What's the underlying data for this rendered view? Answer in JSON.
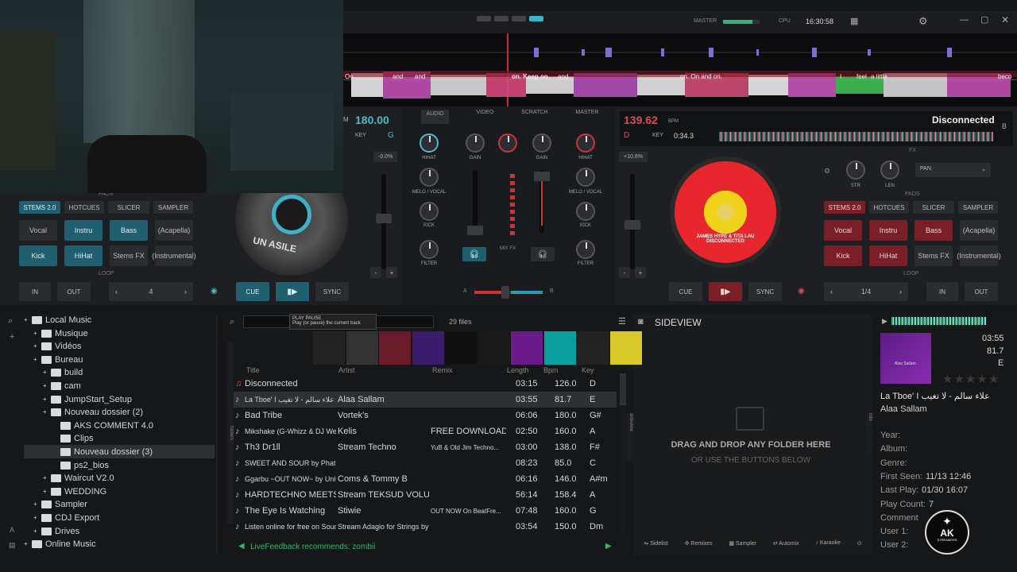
{
  "colors": {
    "teal": "#1f5f70",
    "red": "#8a1e2a",
    "accent": "#4fb8c8"
  },
  "topbar": {
    "master_label": "MASTER",
    "cpu_label": "CPU",
    "time": "16:30:58"
  },
  "lyrics": [
    "On",
    "and",
    "on. Keep on",
    "and",
    "on. On and on.",
    "I",
    "feel",
    "a little",
    "beco"
  ],
  "deck_left": {
    "bpm": "180.00",
    "key_label": "KEY",
    "key_value": "G",
    "pitch": "-0.0%",
    "pads_label": "PADS",
    "pad_modes": [
      "STEMS 2.0",
      "HOTCUES",
      "SLICER",
      "SAMPLER"
    ],
    "pads": [
      "Vocal",
      "Instru",
      "Bass",
      "(Acapella)",
      "Kick",
      "HiHat",
      "Stems FX",
      "(Instrumental)"
    ],
    "loop_label": "LOOP",
    "loop_in": "IN",
    "loop_out": "OUT",
    "loop_size": "4",
    "cue": "CUE",
    "sync": "SYNC",
    "platter_text": "UN ASILE"
  },
  "deck_right": {
    "bpm": "139.62",
    "bpm_label": "BPM",
    "key_value": "D",
    "key_label": "KEY",
    "time": "0:34.3",
    "title": "Disconnected",
    "deck_letter": "B",
    "pitch": "+10.6%",
    "fx_label": "FX",
    "fx_knobs": [
      "STR",
      "LEN"
    ],
    "fx_select": "PAN",
    "pads_label": "PADS",
    "pad_modes": [
      "STEMS 2.0",
      "HOTCUES",
      "SLICER",
      "SAMPLER"
    ],
    "pads": [
      "Vocal",
      "Instru",
      "Bass",
      "(Acapella)",
      "Kick",
      "HiHat",
      "Stems FX",
      "(Instrumental)"
    ],
    "loop_label": "LOOP",
    "loop_in": "IN",
    "loop_out": "OUT",
    "loop_size": "1/4",
    "cue": "CUE",
    "sync": "SYNC",
    "platter_text": "JAMES HYPE & TITA LAU DISCONNECTED"
  },
  "mixer": {
    "tabs": [
      "AUDIO",
      "VIDEO",
      "SCRATCH",
      "MASTER"
    ],
    "left_knobs": [
      "HIHAT",
      "MELO / VOCAL",
      "KICK",
      "FILTER"
    ],
    "right_knobs": [
      "HIHAT",
      "MELO / VOCAL",
      "KICK",
      "FILTER"
    ],
    "gain": "GAIN",
    "mixfx": "MIX FX",
    "cross_a": "A",
    "cross_b": "B"
  },
  "tree": [
    {
      "label": "Local Music",
      "indent": 0
    },
    {
      "label": "Musique",
      "indent": 1
    },
    {
      "label": "Vidéos",
      "indent": 1
    },
    {
      "label": "Bureau",
      "indent": 1
    },
    {
      "label": "build",
      "indent": 2
    },
    {
      "label": "cam",
      "indent": 2
    },
    {
      "label": "JumpStart_Setup",
      "indent": 2
    },
    {
      "label": "Nouveau dossier (2)",
      "indent": 2
    },
    {
      "label": "AKS COMMENT 4.0",
      "indent": 3
    },
    {
      "label": "Clips",
      "indent": 3
    },
    {
      "label": "Nouveau dossier (3)",
      "indent": 3
    },
    {
      "label": "ps2_bios",
      "indent": 3
    },
    {
      "label": "Waircut V2.0",
      "indent": 2
    },
    {
      "label": "WEDDING",
      "indent": 2
    },
    {
      "label": "Sampler",
      "indent": 1
    },
    {
      "label": "CDJ Export",
      "indent": 1
    },
    {
      "label": "Drives",
      "indent": 1
    },
    {
      "label": "Online Music",
      "indent": 0
    }
  ],
  "browser": {
    "tooltip_title": "PLAY PAUSE",
    "tooltip_text": "Play (or pause) the current track",
    "file_count": "29 files",
    "folders_tab": "folders",
    "sideview_tab": "sideview",
    "info_tab": "info",
    "columns": [
      "Title",
      "Artist",
      "Remix",
      "Length",
      "Bpm",
      "Key"
    ],
    "tracks": [
      [
        "Disconnected",
        "",
        "",
        "03:15",
        "126.0",
        "D"
      ],
      [
        "La Tboe' I علاء سالم - لا تغيب",
        "Alaa Sallam",
        "",
        "03:55",
        "81.7",
        "E"
      ],
      [
        "Bad Tribe",
        "Vortek's",
        "",
        "06:06",
        "180.0",
        "G#"
      ],
      [
        "Mikshake (G-Whizz & DJ Web...",
        "Kelis",
        "FREE DOWNLOAD",
        "02:50",
        "160.0",
        "A"
      ],
      [
        "Th3 Dr1ll",
        "Stream Techno",
        "YuB & Old Jim Techno...",
        "03:00",
        "138.0",
        "F#"
      ],
      [
        "SWEET AND SOUR by Phat Otiz",
        "",
        "",
        "08:23",
        "85.0",
        "C"
      ],
      [
        "Ggarbu ~OUT NOW~ by Unit...",
        "Coms & Tommy B",
        "",
        "06:16",
        "146.0",
        "A#m"
      ],
      [
        "HARDTECHNO MEETS ACID...",
        "Stream TEKSUD VOLUTION",
        "",
        "56:14",
        "158.4",
        "A"
      ],
      [
        "The Eye Is Watching",
        "Stiwie",
        "OUT NOW On BeatFre...",
        "07:48",
        "160.0",
        "G"
      ],
      [
        "Listen online for free on Sound...",
        "Stream Adagio for Strings by J...",
        "",
        "03:54",
        "150.0",
        "Dm"
      ]
    ],
    "livefeedback": "LiveFeedback recommends: zombii"
  },
  "sideview": {
    "title": "SIDEVIEW",
    "drag_text": "DRAG AND DROP ANY FOLDER HERE",
    "or_text": "OR USE THE BUTTONS BELOW",
    "buttons": [
      "Sidelist",
      "Remixes",
      "Sampler",
      "Automix",
      "Karaoke"
    ]
  },
  "info": {
    "length": "03:55",
    "bpm": "81.7",
    "key": "E",
    "title": "La Tboe' I علاء سالم - لا تغيب",
    "artist": "Alaa Sallam",
    "album_art_text": "Alaa Sallam",
    "fields": [
      {
        "k": "Year:",
        "v": ""
      },
      {
        "k": "Album:",
        "v": ""
      },
      {
        "k": "Genre:",
        "v": ""
      },
      {
        "k": "First Seen:",
        "v": "11/13 12:46"
      },
      {
        "k": "Last Play:",
        "v": "01/30 16:07"
      },
      {
        "k": "Play Count:",
        "v": "7"
      },
      {
        "k": "Comment",
        "v": ""
      },
      {
        "k": "User 1:",
        "v": ""
      },
      {
        "k": "User 2:",
        "v": ""
      }
    ]
  },
  "watermark": {
    "text": "AK",
    "sub": "STREAMERS"
  }
}
